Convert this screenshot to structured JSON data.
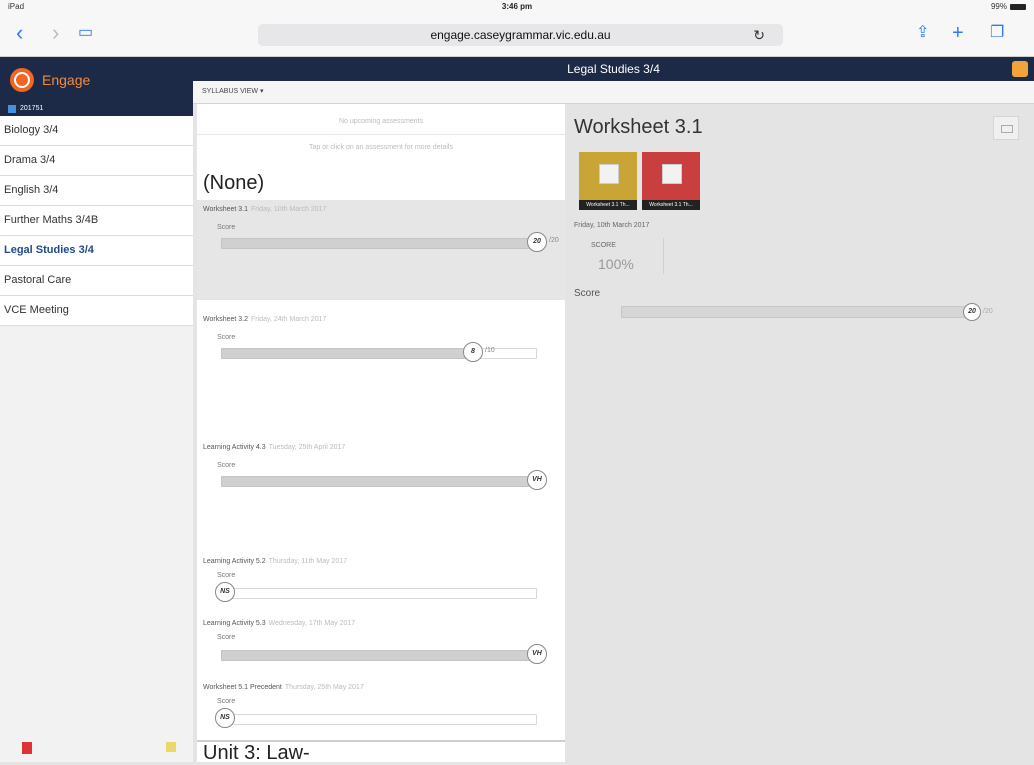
{
  "status": {
    "device": "iPad",
    "time": "3:46 pm",
    "battery": "99%"
  },
  "browser": {
    "url": "engage.caseygrammar.vic.edu.au"
  },
  "brand": {
    "name": "Engage"
  },
  "sidebar": {
    "term": "201751",
    "items": [
      {
        "label": "Biology 3/4"
      },
      {
        "label": "Drama 3/4"
      },
      {
        "label": "English 3/4"
      },
      {
        "label": "Further Maths 3/4B"
      },
      {
        "label": "Legal Studies 3/4"
      },
      {
        "label": "Pastoral Care"
      },
      {
        "label": "VCE Meeting"
      }
    ]
  },
  "header": {
    "title": "Legal Studies 3/4",
    "syllabus": "SYLLABUS VIEW ▾"
  },
  "middle": {
    "upcoming": "No upcoming assessments",
    "hint": "Tap or click on an assessment for more details",
    "section_title": "(None)",
    "unit_title": "Unit 3: Law-",
    "assessments": [
      {
        "title": "Worksheet 3.1",
        "date": "Friday, 10th March 2017",
        "score_label": "Score",
        "mark": "20",
        "out_of": "/20",
        "fraction": 1.0,
        "selected": true
      },
      {
        "title": "Worksheet 3.2",
        "date": "Friday, 24th March 2017",
        "score_label": "Score",
        "mark": "8",
        "out_of": "/10",
        "fraction": 0.8
      },
      {
        "title": "Learning Activity 4.3",
        "date": "Tuesday, 25th April 2017",
        "score_label": "Score",
        "mark": "VH",
        "out_of": "",
        "fraction": 1.0
      },
      {
        "title": "Learning Activity 5.2",
        "date": "Thursday, 11th May 2017",
        "score_label": "Score",
        "mark": "NS",
        "out_of": "",
        "fraction": 0
      },
      {
        "title": "Learning Activity 5.3",
        "date": "Wednesday, 17th May 2017",
        "score_label": "Score",
        "mark": "VH",
        "out_of": "",
        "fraction": 1.0
      },
      {
        "title": "Worksheet 5.1 Precedent",
        "date": "Thursday, 25th May 2017",
        "score_label": "Score",
        "mark": "NS",
        "out_of": "",
        "fraction": 0
      }
    ]
  },
  "detail": {
    "title": "Worksheet 3.1",
    "files": [
      {
        "caption": "Worksheet 3.1 Th..."
      },
      {
        "caption": "Worksheet 3.1 Th..."
      }
    ],
    "date": "Friday, 10th March 2017",
    "score_heading": "SCORE",
    "score_pct": "100%",
    "score_label": "Score",
    "mark": "20",
    "out_of": "/20"
  }
}
